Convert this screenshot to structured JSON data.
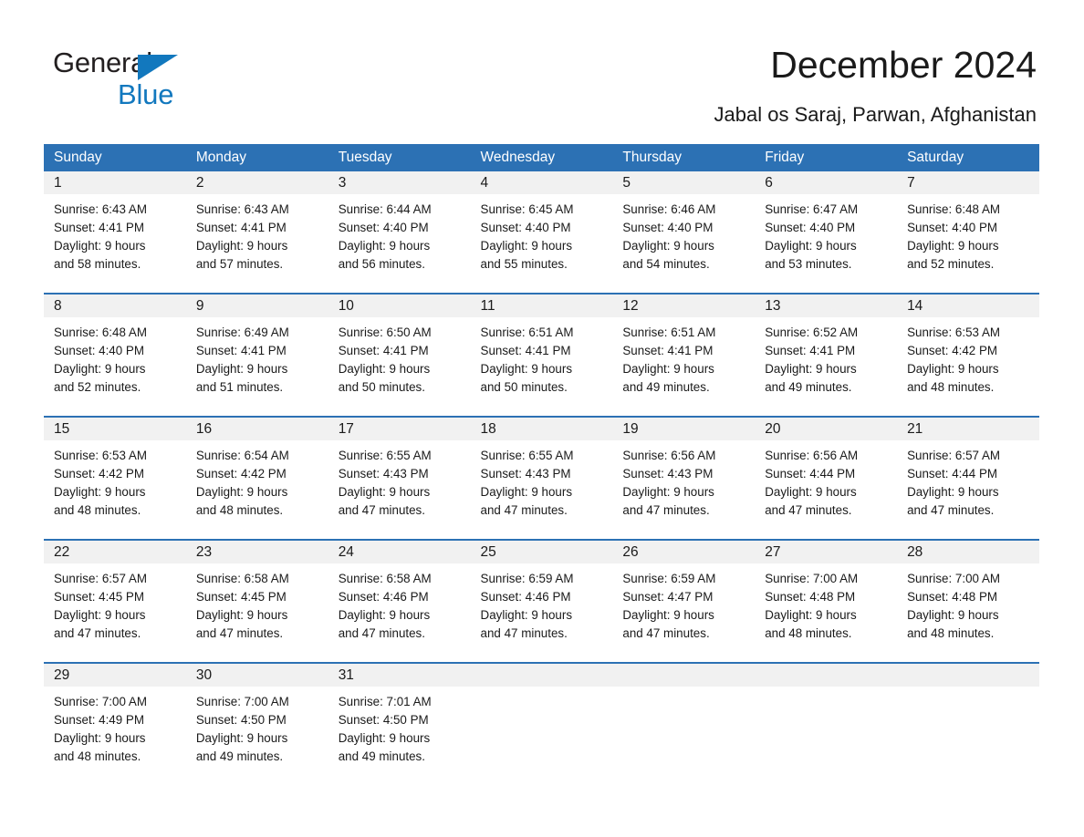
{
  "brand": {
    "name_part1": "General",
    "name_part2": "Blue",
    "triangle_color": "#1278be",
    "text_color": "#231f20"
  },
  "header": {
    "title": "December 2024",
    "subtitle": "Jabal os Saraj, Parwan, Afghanistan"
  },
  "theme": {
    "header_blue": "#2c71b4",
    "day_band_gray": "#f1f1f1",
    "row_rule_blue": "#2c71b4"
  },
  "calendar": {
    "weekday_headers": [
      "Sunday",
      "Monday",
      "Tuesday",
      "Wednesday",
      "Thursday",
      "Friday",
      "Saturday"
    ],
    "weeks": [
      [
        {
          "day": "1",
          "lines": [
            "Sunrise: 6:43 AM",
            "Sunset: 4:41 PM",
            "Daylight: 9 hours",
            "and 58 minutes."
          ]
        },
        {
          "day": "2",
          "lines": [
            "Sunrise: 6:43 AM",
            "Sunset: 4:41 PM",
            "Daylight: 9 hours",
            "and 57 minutes."
          ]
        },
        {
          "day": "3",
          "lines": [
            "Sunrise: 6:44 AM",
            "Sunset: 4:40 PM",
            "Daylight: 9 hours",
            "and 56 minutes."
          ]
        },
        {
          "day": "4",
          "lines": [
            "Sunrise: 6:45 AM",
            "Sunset: 4:40 PM",
            "Daylight: 9 hours",
            "and 55 minutes."
          ]
        },
        {
          "day": "5",
          "lines": [
            "Sunrise: 6:46 AM",
            "Sunset: 4:40 PM",
            "Daylight: 9 hours",
            "and 54 minutes."
          ]
        },
        {
          "day": "6",
          "lines": [
            "Sunrise: 6:47 AM",
            "Sunset: 4:40 PM",
            "Daylight: 9 hours",
            "and 53 minutes."
          ]
        },
        {
          "day": "7",
          "lines": [
            "Sunrise: 6:48 AM",
            "Sunset: 4:40 PM",
            "Daylight: 9 hours",
            "and 52 minutes."
          ]
        }
      ],
      [
        {
          "day": "8",
          "lines": [
            "Sunrise: 6:48 AM",
            "Sunset: 4:40 PM",
            "Daylight: 9 hours",
            "and 52 minutes."
          ]
        },
        {
          "day": "9",
          "lines": [
            "Sunrise: 6:49 AM",
            "Sunset: 4:41 PM",
            "Daylight: 9 hours",
            "and 51 minutes."
          ]
        },
        {
          "day": "10",
          "lines": [
            "Sunrise: 6:50 AM",
            "Sunset: 4:41 PM",
            "Daylight: 9 hours",
            "and 50 minutes."
          ]
        },
        {
          "day": "11",
          "lines": [
            "Sunrise: 6:51 AM",
            "Sunset: 4:41 PM",
            "Daylight: 9 hours",
            "and 50 minutes."
          ]
        },
        {
          "day": "12",
          "lines": [
            "Sunrise: 6:51 AM",
            "Sunset: 4:41 PM",
            "Daylight: 9 hours",
            "and 49 minutes."
          ]
        },
        {
          "day": "13",
          "lines": [
            "Sunrise: 6:52 AM",
            "Sunset: 4:41 PM",
            "Daylight: 9 hours",
            "and 49 minutes."
          ]
        },
        {
          "day": "14",
          "lines": [
            "Sunrise: 6:53 AM",
            "Sunset: 4:42 PM",
            "Daylight: 9 hours",
            "and 48 minutes."
          ]
        }
      ],
      [
        {
          "day": "15",
          "lines": [
            "Sunrise: 6:53 AM",
            "Sunset: 4:42 PM",
            "Daylight: 9 hours",
            "and 48 minutes."
          ]
        },
        {
          "day": "16",
          "lines": [
            "Sunrise: 6:54 AM",
            "Sunset: 4:42 PM",
            "Daylight: 9 hours",
            "and 48 minutes."
          ]
        },
        {
          "day": "17",
          "lines": [
            "Sunrise: 6:55 AM",
            "Sunset: 4:43 PM",
            "Daylight: 9 hours",
            "and 47 minutes."
          ]
        },
        {
          "day": "18",
          "lines": [
            "Sunrise: 6:55 AM",
            "Sunset: 4:43 PM",
            "Daylight: 9 hours",
            "and 47 minutes."
          ]
        },
        {
          "day": "19",
          "lines": [
            "Sunrise: 6:56 AM",
            "Sunset: 4:43 PM",
            "Daylight: 9 hours",
            "and 47 minutes."
          ]
        },
        {
          "day": "20",
          "lines": [
            "Sunrise: 6:56 AM",
            "Sunset: 4:44 PM",
            "Daylight: 9 hours",
            "and 47 minutes."
          ]
        },
        {
          "day": "21",
          "lines": [
            "Sunrise: 6:57 AM",
            "Sunset: 4:44 PM",
            "Daylight: 9 hours",
            "and 47 minutes."
          ]
        }
      ],
      [
        {
          "day": "22",
          "lines": [
            "Sunrise: 6:57 AM",
            "Sunset: 4:45 PM",
            "Daylight: 9 hours",
            "and 47 minutes."
          ]
        },
        {
          "day": "23",
          "lines": [
            "Sunrise: 6:58 AM",
            "Sunset: 4:45 PM",
            "Daylight: 9 hours",
            "and 47 minutes."
          ]
        },
        {
          "day": "24",
          "lines": [
            "Sunrise: 6:58 AM",
            "Sunset: 4:46 PM",
            "Daylight: 9 hours",
            "and 47 minutes."
          ]
        },
        {
          "day": "25",
          "lines": [
            "Sunrise: 6:59 AM",
            "Sunset: 4:46 PM",
            "Daylight: 9 hours",
            "and 47 minutes."
          ]
        },
        {
          "day": "26",
          "lines": [
            "Sunrise: 6:59 AM",
            "Sunset: 4:47 PM",
            "Daylight: 9 hours",
            "and 47 minutes."
          ]
        },
        {
          "day": "27",
          "lines": [
            "Sunrise: 7:00 AM",
            "Sunset: 4:48 PM",
            "Daylight: 9 hours",
            "and 48 minutes."
          ]
        },
        {
          "day": "28",
          "lines": [
            "Sunrise: 7:00 AM",
            "Sunset: 4:48 PM",
            "Daylight: 9 hours",
            "and 48 minutes."
          ]
        }
      ],
      [
        {
          "day": "29",
          "lines": [
            "Sunrise: 7:00 AM",
            "Sunset: 4:49 PM",
            "Daylight: 9 hours",
            "and 48 minutes."
          ]
        },
        {
          "day": "30",
          "lines": [
            "Sunrise: 7:00 AM",
            "Sunset: 4:50 PM",
            "Daylight: 9 hours",
            "and 49 minutes."
          ]
        },
        {
          "day": "31",
          "lines": [
            "Sunrise: 7:01 AM",
            "Sunset: 4:50 PM",
            "Daylight: 9 hours",
            "and 49 minutes."
          ]
        },
        {
          "day": "",
          "lines": []
        },
        {
          "day": "",
          "lines": []
        },
        {
          "day": "",
          "lines": []
        },
        {
          "day": "",
          "lines": []
        }
      ]
    ]
  }
}
